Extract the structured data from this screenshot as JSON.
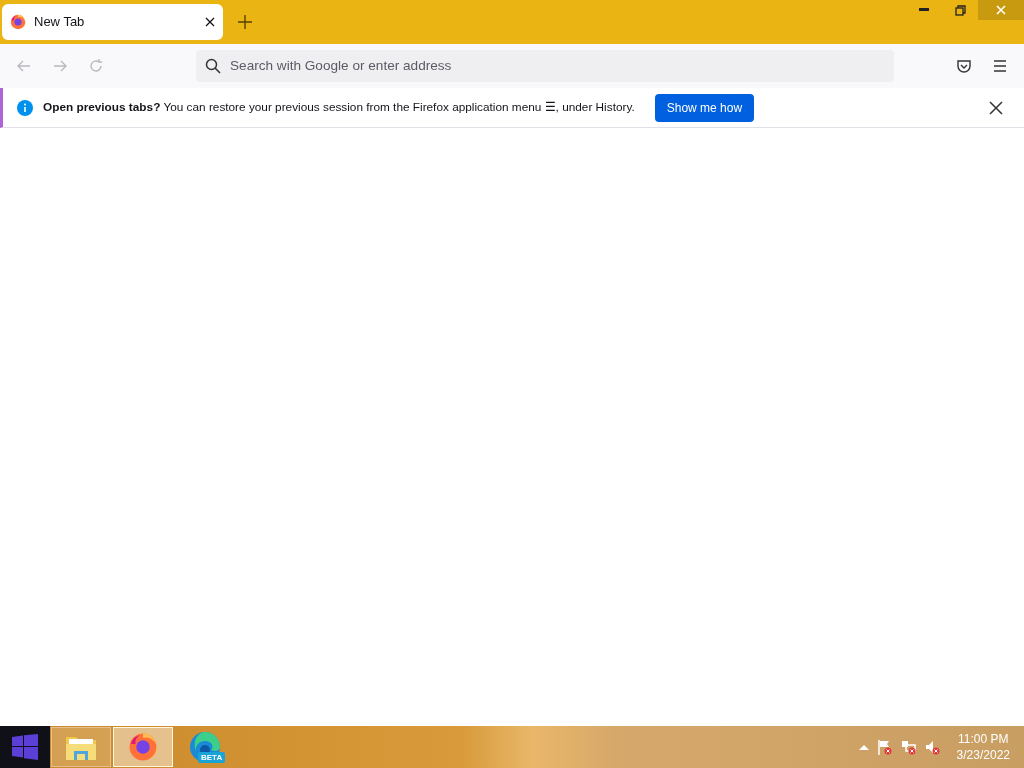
{
  "tabs": [
    {
      "title": "New Tab",
      "selected": true
    }
  ],
  "toolbar": {
    "search_placeholder": "Search with Google or enter address"
  },
  "notification": {
    "message": "**Open previous tabs?** You can restore your previous session from the Firefox application menu ☰, under History.",
    "button": "Show me how"
  },
  "taskbar": {
    "apps": [
      {
        "kind": "explorer",
        "running": true,
        "selected": false
      },
      {
        "kind": "firefox",
        "running": true,
        "selected": true
      },
      {
        "kind": "edge",
        "running": false,
        "selected": false,
        "badge": "BETA"
      }
    ],
    "time": "11:00 PM",
    "date": "3/23/2022"
  }
}
